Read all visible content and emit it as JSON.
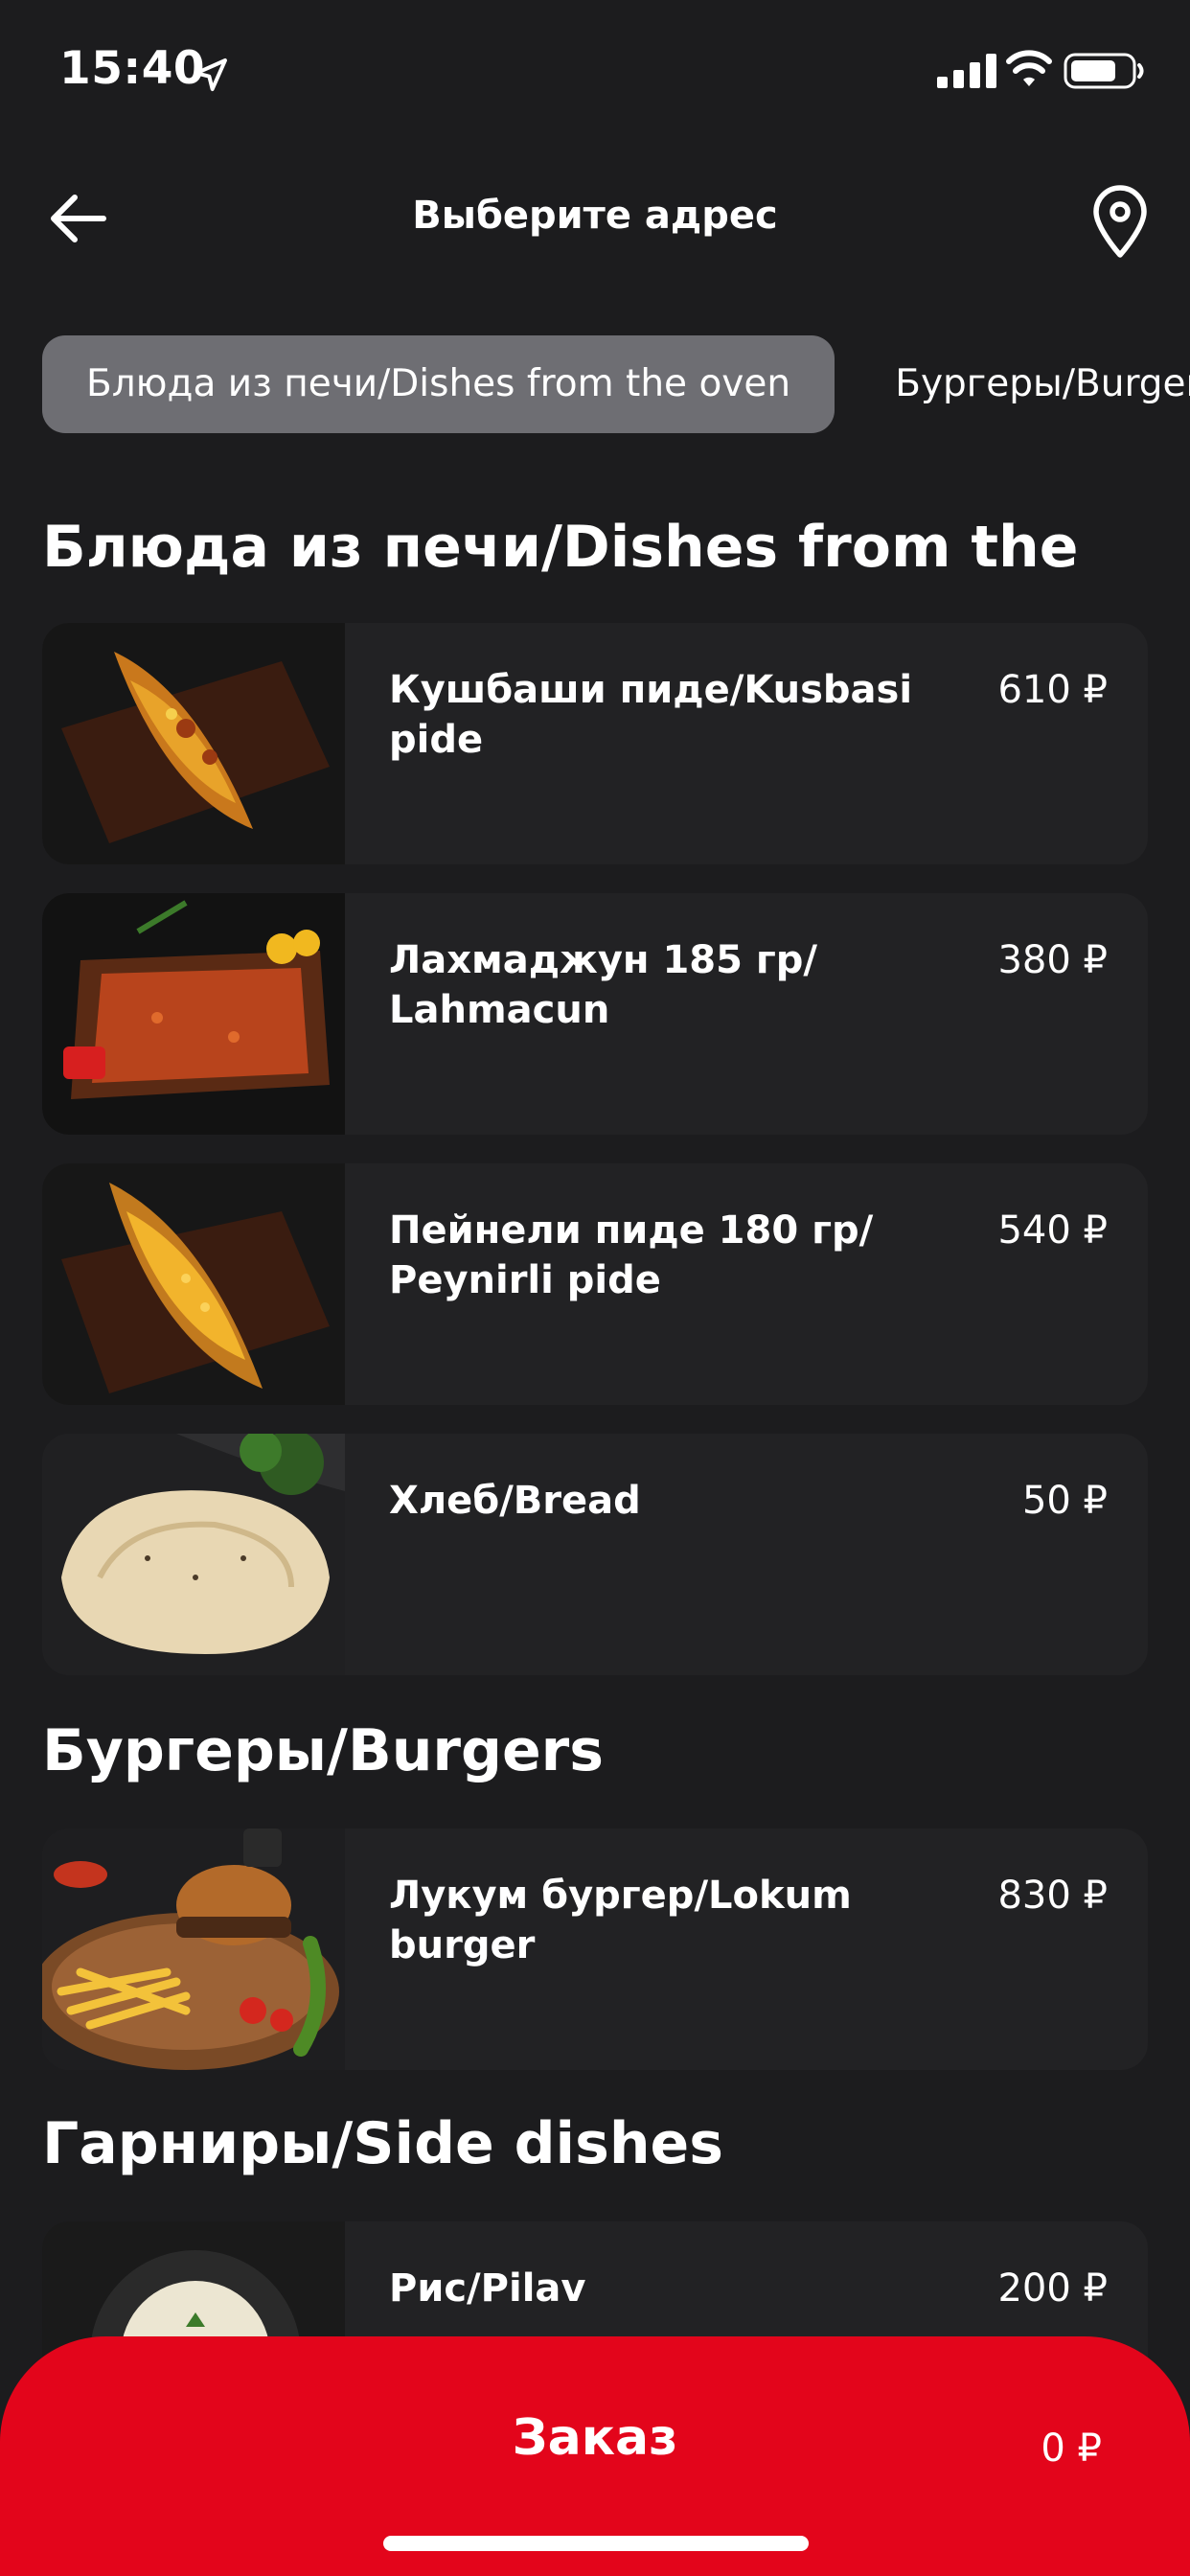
{
  "status_bar": {
    "time": "15:40"
  },
  "header": {
    "title": "Выберите адрес"
  },
  "tabs": [
    {
      "label": "Блюда из печи/Dishes from the oven",
      "active": true
    },
    {
      "label": "Бургеры/Burgers",
      "active": false
    }
  ],
  "sections": [
    {
      "title": "Блюда из печи/Dishes from the"
    },
    {
      "title": "Бургеры/Burgers"
    },
    {
      "title": "Гарниры/Side dishes"
    }
  ],
  "items": [
    {
      "name": "Кушбаши пиде/Kusbasi pide",
      "price": "610 ₽"
    },
    {
      "name": "Лахмаджун 185 гр/ Lahmacun",
      "price": "380 ₽"
    },
    {
      "name": "Пейнели пиде 180 гр/ Peynirli pide",
      "price": "540 ₽"
    },
    {
      "name": "Хлеб/Bread",
      "price": "50 ₽"
    },
    {
      "name": "Лукум бургер/Lokum burger",
      "price": "830 ₽"
    },
    {
      "name": "Рис/Pilav",
      "price": "200 ₽"
    }
  ],
  "order": {
    "label": "Заказ",
    "total": "0 ₽"
  },
  "colors": {
    "background": "#1c1c1e",
    "card": "#222224",
    "active_tab": "#6e6e73",
    "accent": "#e3051b"
  },
  "icons": [
    "location-arrow-icon",
    "signal-icon",
    "wifi-icon",
    "battery-icon",
    "back-arrow-icon",
    "map-pin-icon"
  ]
}
